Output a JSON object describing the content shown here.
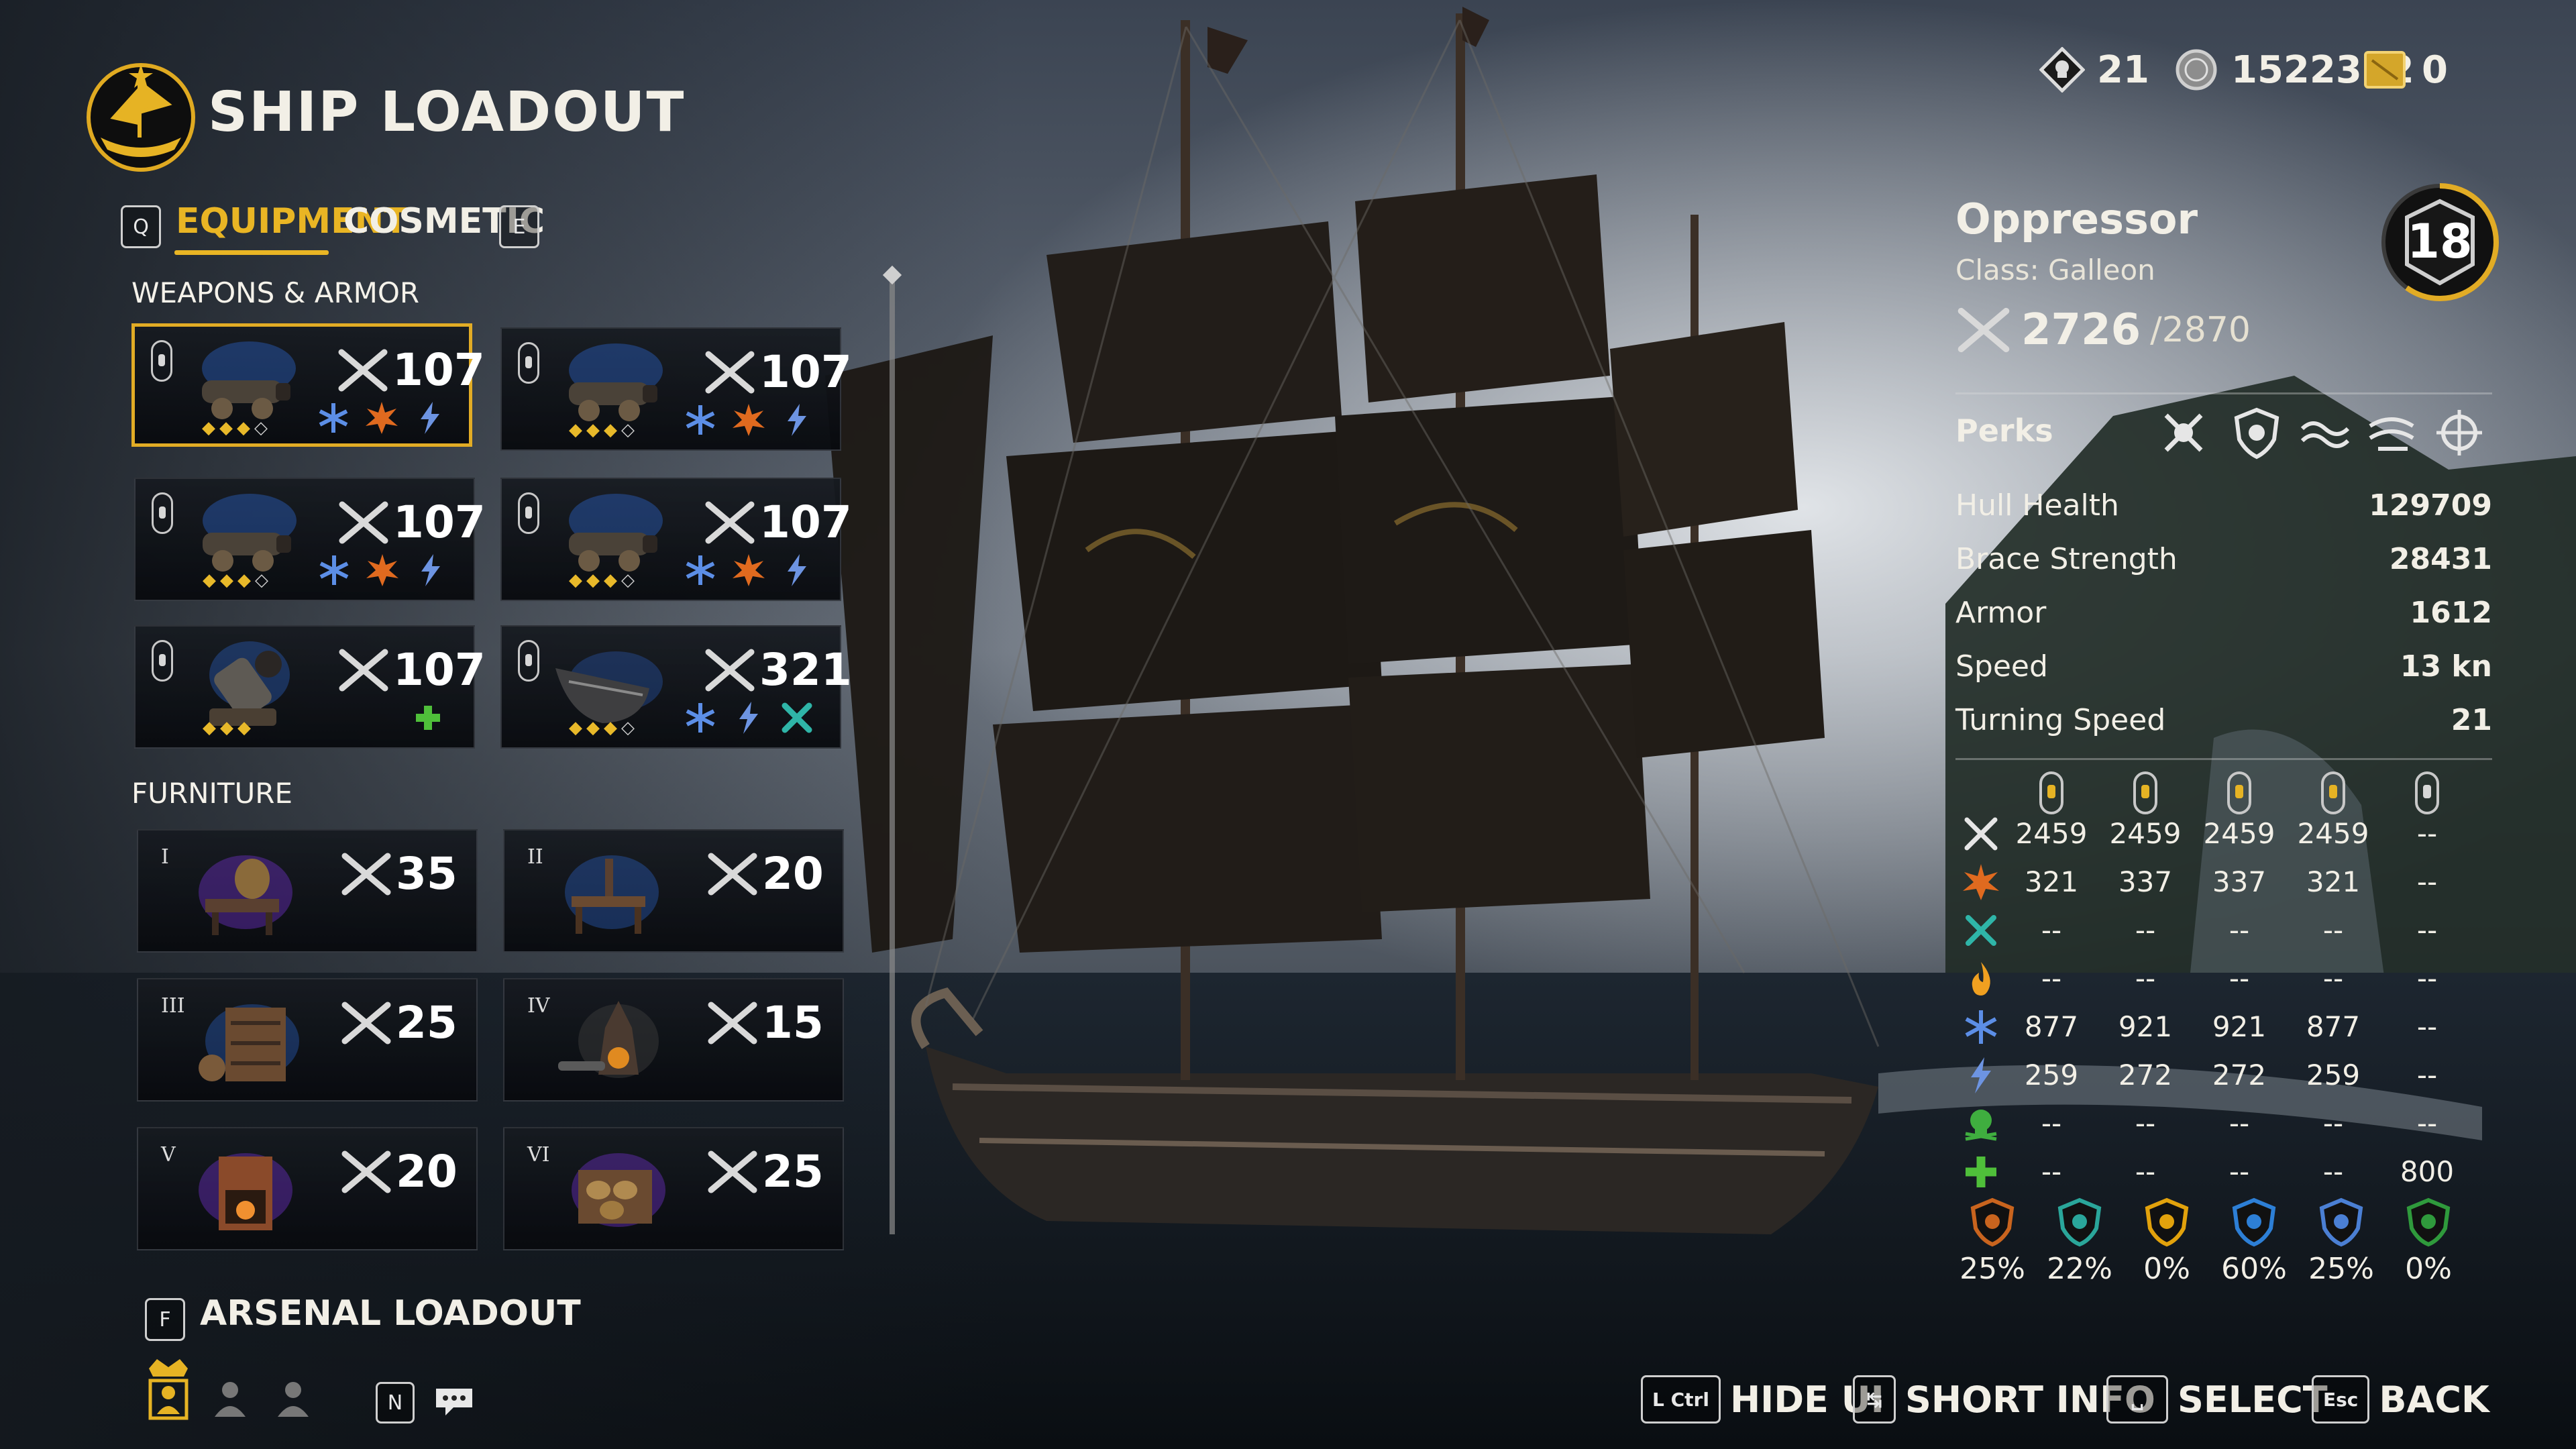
{
  "header": {
    "title": "SHIP LOADOUT",
    "tab_prev_key": "Q",
    "tab_next_key": "E",
    "tabs": [
      {
        "label": "EQUIPMENT",
        "active": true
      },
      {
        "label": "COSMETIC",
        "active": false
      }
    ]
  },
  "currencies": [
    {
      "icon": "skull-token-icon",
      "value": "21"
    },
    {
      "icon": "silver-coin-icon",
      "value": "1522362"
    },
    {
      "icon": "gold-ingot-icon",
      "value": "0"
    }
  ],
  "weapons_section": {
    "title": "WEAPONS & ARMOR",
    "slots": [
      {
        "item": "long-gun-cannon",
        "score": "107",
        "selected": true,
        "gems_filled": 3,
        "gems_total": 4,
        "mods": [
          "frost-icon",
          "explosion-icon",
          "lightning-icon"
        ]
      },
      {
        "item": "long-gun-cannon",
        "score": "107",
        "selected": false,
        "gems_filled": 3,
        "gems_total": 4,
        "mods": [
          "frost-icon",
          "explosion-icon",
          "lightning-icon"
        ]
      },
      {
        "item": "long-gun-cannon",
        "score": "107",
        "selected": false,
        "gems_filled": 3,
        "gems_total": 4,
        "mods": [
          "frost-icon",
          "explosion-icon",
          "lightning-icon"
        ]
      },
      {
        "item": "long-gun-cannon",
        "score": "107",
        "selected": false,
        "gems_filled": 3,
        "gems_total": 4,
        "mods": [
          "frost-icon",
          "explosion-icon",
          "lightning-icon"
        ]
      },
      {
        "item": "mortar",
        "score": "107",
        "selected": false,
        "gems_filled": 3,
        "gems_total": 3,
        "mods": [
          "heal-plus-icon"
        ]
      },
      {
        "item": "hull-armor",
        "score": "321",
        "selected": false,
        "gems_filled": 3,
        "gems_total": 4,
        "mods": [
          "frost-icon",
          "lightning-icon",
          "repair-icon"
        ]
      }
    ]
  },
  "furniture_section": {
    "title": "FURNITURE",
    "slots": [
      {
        "tier": "I",
        "item": "alchemy-bench",
        "score": "35"
      },
      {
        "tier": "II",
        "item": "workbench",
        "score": "20"
      },
      {
        "tier": "III",
        "item": "shelf-cabinet",
        "score": "25"
      },
      {
        "tier": "IV",
        "item": "furnace",
        "score": "15"
      },
      {
        "tier": "V",
        "item": "forge",
        "score": "20"
      },
      {
        "tier": "VI",
        "item": "supply-rack",
        "score": "25"
      }
    ]
  },
  "arsenal": {
    "key": "F",
    "label": "ARSENAL LOADOUT",
    "n_key": "N"
  },
  "ship": {
    "name": "Oppressor",
    "class": "Class: Galleon",
    "power": "2726",
    "power_max": "/2870",
    "level": "18",
    "level_progress": 0.6,
    "perks_label": "Perks",
    "perks": [
      "boarding-icon",
      "shield-perk-icon",
      "waves-icon",
      "wind-icon",
      "crosshair-icon"
    ],
    "stats": [
      {
        "label": "Hull Health",
        "value": "129709"
      },
      {
        "label": "Brace Strength",
        "value": "28431"
      },
      {
        "label": "Armor",
        "value": "1612"
      },
      {
        "label": "Speed",
        "value": "13 kn"
      },
      {
        "label": "Turning Speed",
        "value": "21"
      }
    ]
  },
  "armament_table": {
    "row_icons": [
      "swords-icon",
      "explosion-icon",
      "tear-icon",
      "fire-icon",
      "frost-icon",
      "lightning-icon",
      "skull-icon",
      "heal-plus-icon"
    ],
    "rows": [
      [
        "2459",
        "2459",
        "2459",
        "2459",
        "--"
      ],
      [
        "321",
        "337",
        "337",
        "321",
        "--"
      ],
      [
        "--",
        "--",
        "--",
        "--",
        "--"
      ],
      [
        "--",
        "--",
        "--",
        "--",
        "--"
      ],
      [
        "877",
        "921",
        "921",
        "877",
        "--"
      ],
      [
        "259",
        "272",
        "272",
        "259",
        "--"
      ],
      [
        "--",
        "--",
        "--",
        "--",
        "--"
      ],
      [
        "--",
        "--",
        "--",
        "--",
        "800"
      ]
    ],
    "resistances": [
      {
        "icon": "explosion-resist-icon",
        "color": "#c9641e",
        "value": "25%"
      },
      {
        "icon": "tear-resist-icon",
        "color": "#2aa69a",
        "value": "22%"
      },
      {
        "icon": "fire-resist-icon",
        "color": "#e2a20c",
        "value": "0%"
      },
      {
        "icon": "frost-resist-icon",
        "color": "#2d7fd6",
        "value": "60%"
      },
      {
        "icon": "lightning-resist-icon",
        "color": "#4b7fd3",
        "value": "25%"
      },
      {
        "icon": "skull-resist-icon",
        "color": "#2f9a3c",
        "value": "0%"
      }
    ]
  },
  "bottom_bar": [
    {
      "key": "L Ctrl",
      "label": "HIDE UI"
    },
    {
      "key": "Tab",
      "label": "SHORT INFO"
    },
    {
      "key": "Space",
      "label": "SELECT"
    },
    {
      "key": "Esc",
      "label": "BACK"
    }
  ],
  "colors": {
    "accent": "#e9b524",
    "selected_border": "#e2ac25"
  }
}
